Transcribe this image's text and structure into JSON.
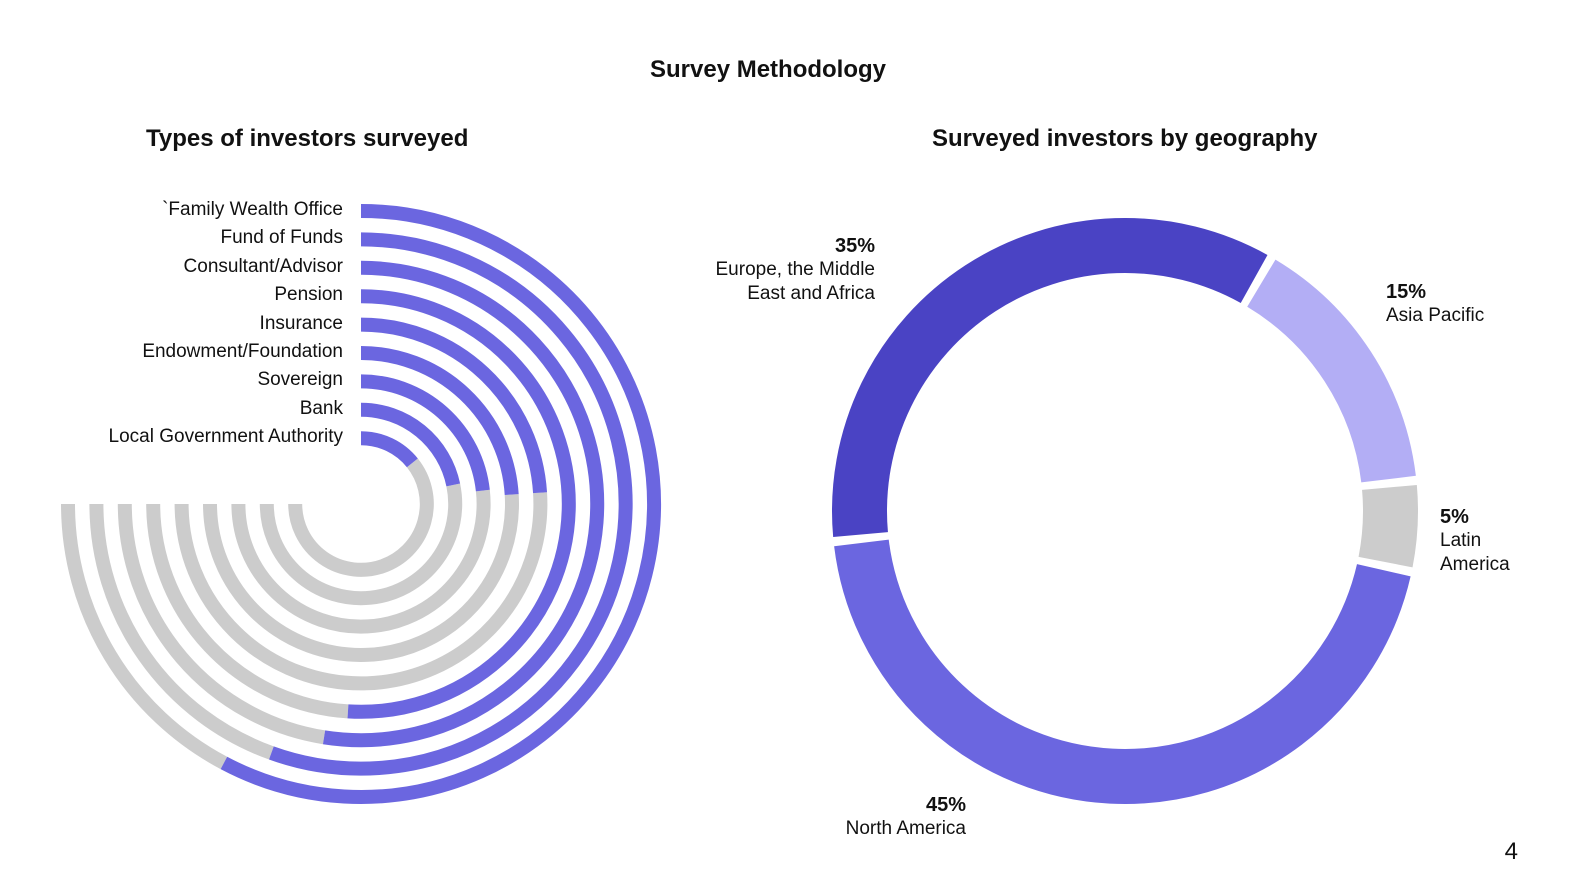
{
  "title": "Survey Methodology",
  "page_number": "4",
  "colors": {
    "accent": "#6b66e0",
    "track": "#cccccc",
    "emea": "#4a43c4",
    "asia": "#b3aef5",
    "latam": "#cccccc",
    "na": "#6b66e0"
  },
  "chart_data": [
    {
      "type": "radial-bar",
      "title": "Types of investors surveyed",
      "categories": [
        "`Family Wealth Office",
        "Fund of Funds",
        "Consultant/Advisor",
        "Pension",
        "Insurance",
        "Endowment/Foundation",
        "Sovereign",
        "Bank",
        "Local Government Authority"
      ],
      "values": [
        77,
        74,
        70,
        68,
        32,
        32,
        31,
        29,
        19
      ],
      "value_max": 100
    },
    {
      "type": "pie",
      "donut": true,
      "title": "Surveyed investors by geography",
      "slices": [
        {
          "label": "Europe, the Middle\nEast and Africa",
          "pct_label": "35%",
          "value": 35,
          "color": "#4a43c4"
        },
        {
          "label": "Asia Pacific",
          "pct_label": "15%",
          "value": 15,
          "color": "#b3aef5"
        },
        {
          "label": "Latin\nAmerica",
          "pct_label": "5%",
          "value": 5,
          "color": "#cccccc"
        },
        {
          "label": "North America",
          "pct_label": "45%",
          "value": 45,
          "color": "#6b66e0"
        }
      ]
    }
  ]
}
